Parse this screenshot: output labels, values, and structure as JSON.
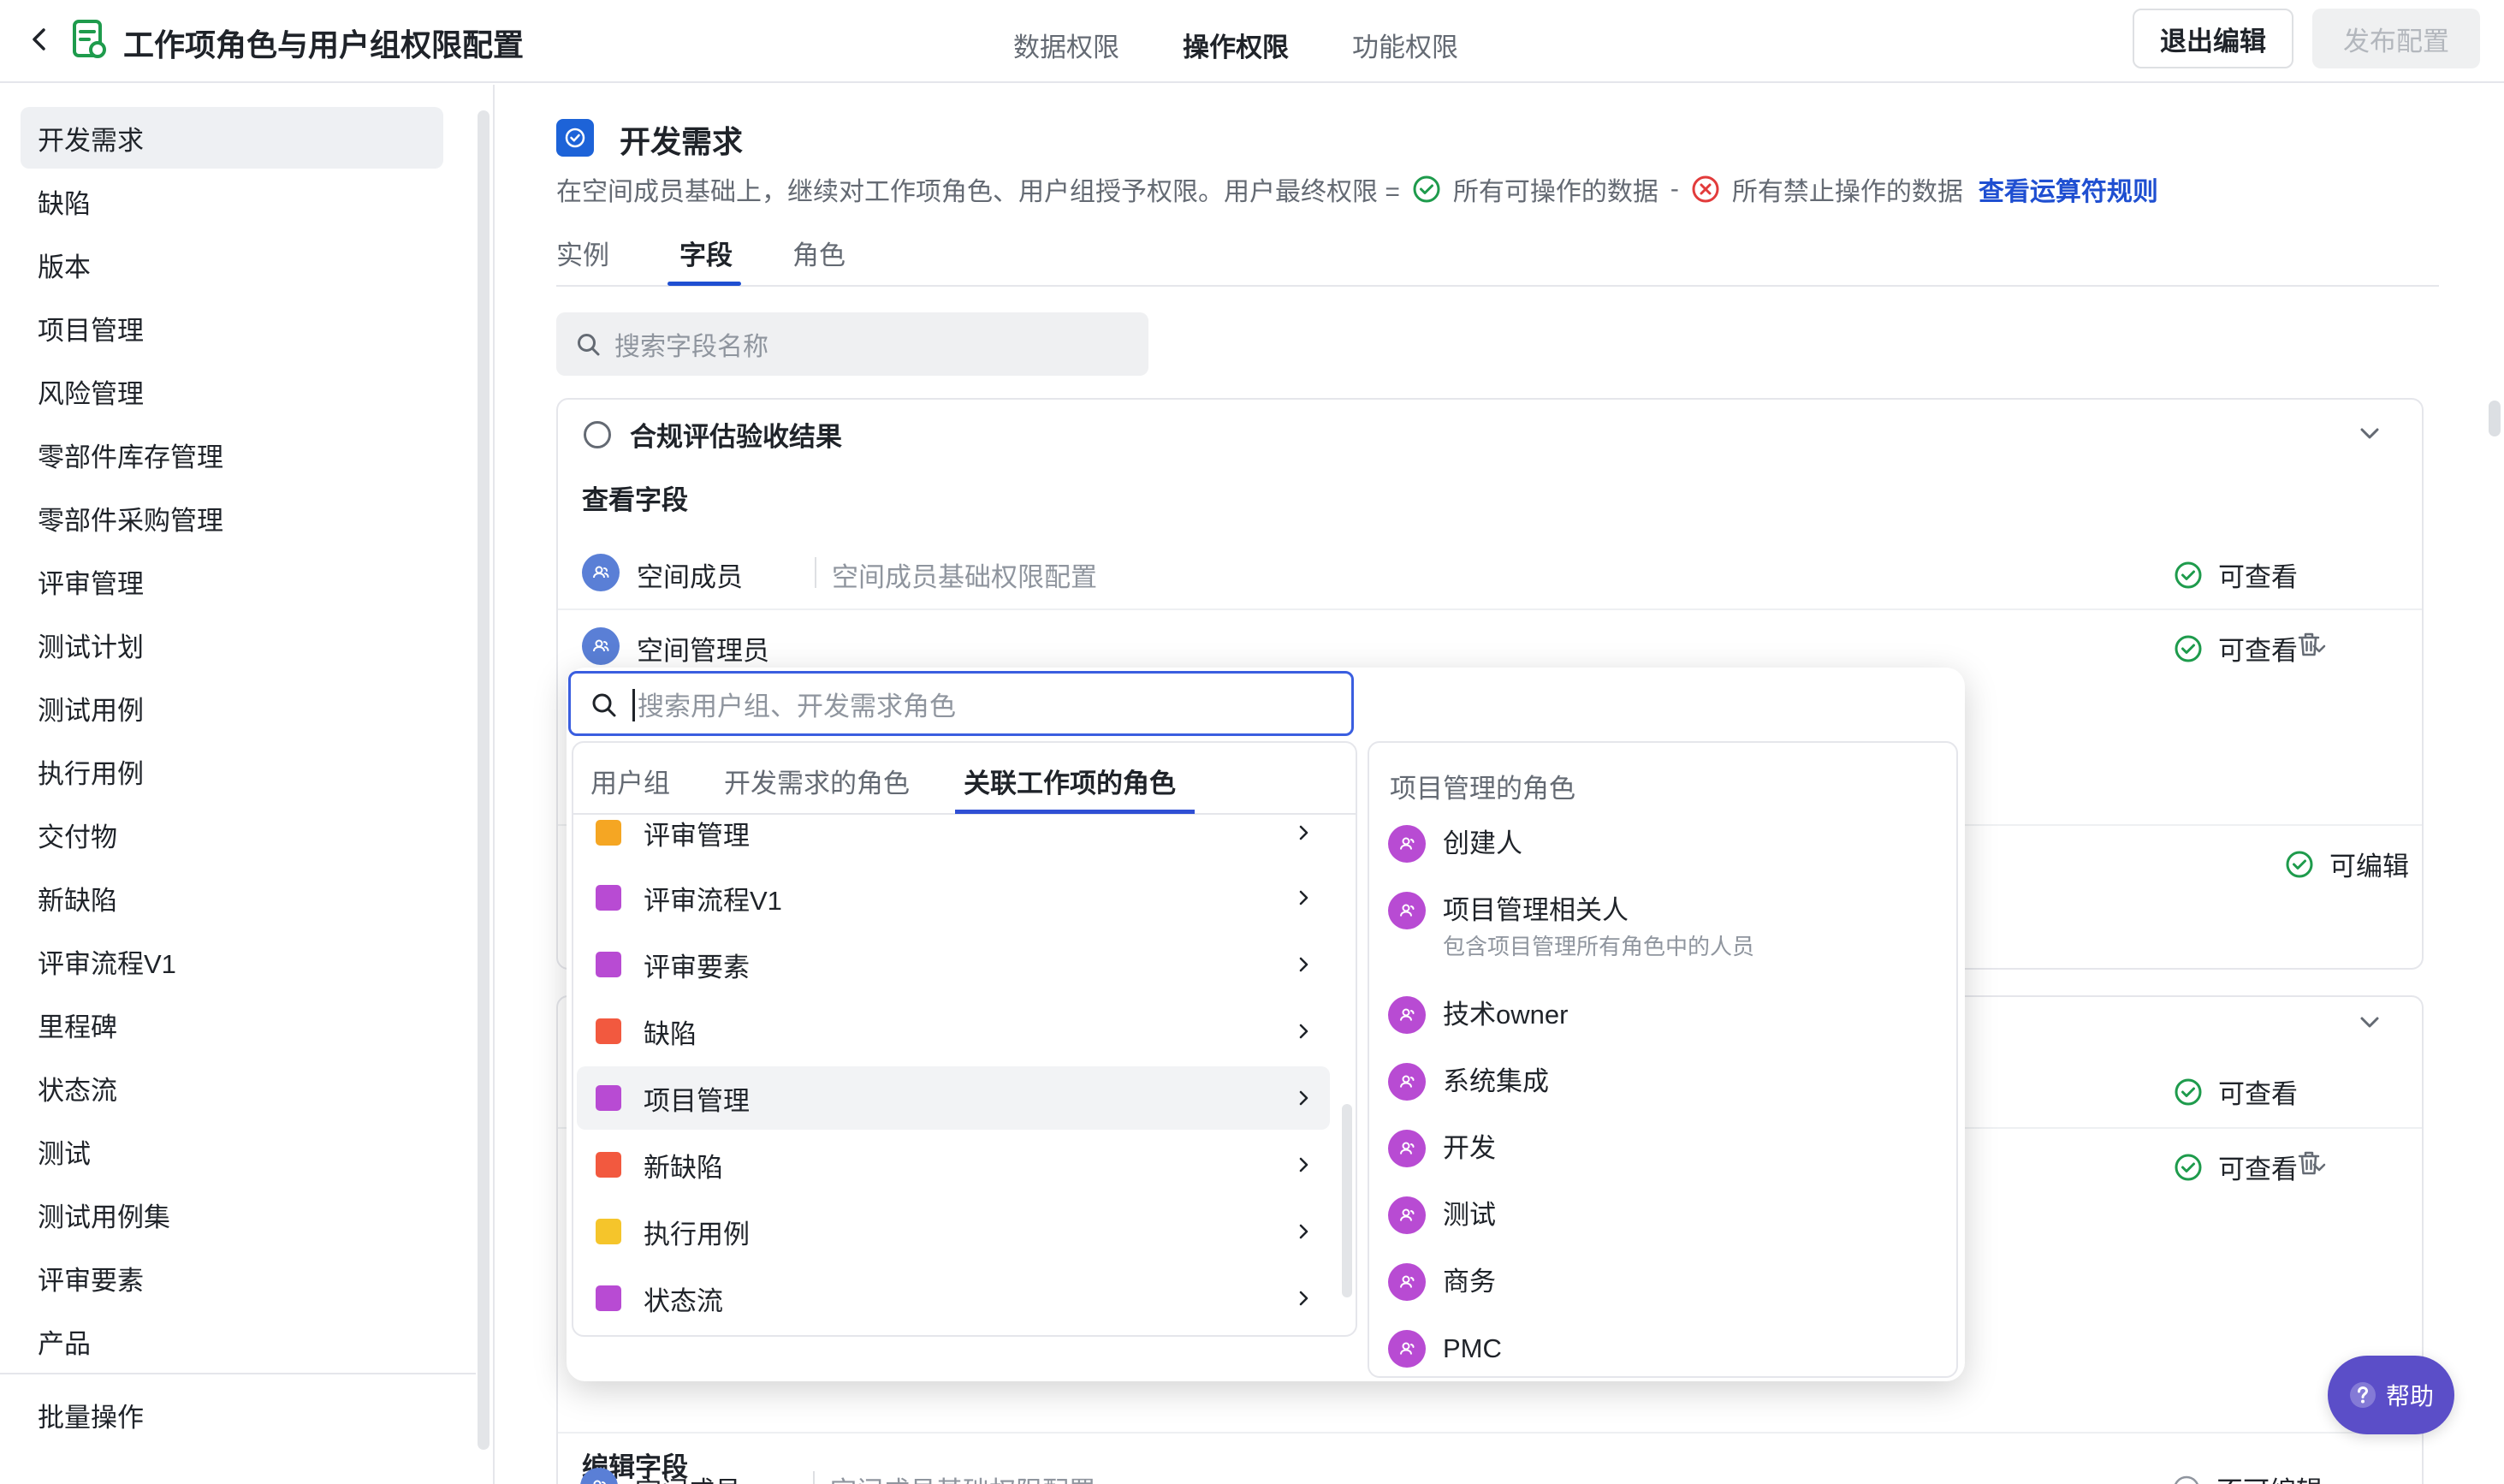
{
  "header": {
    "title": "工作项角色与用户组权限配置",
    "tabs": [
      "数据权限",
      "操作权限",
      "功能权限"
    ],
    "active_tab": "操作权限",
    "exit_label": "退出编辑",
    "publish_label": "发布配置"
  },
  "sidebar": {
    "items": [
      "开发需求",
      "缺陷",
      "版本",
      "项目管理",
      "风险管理",
      "零部件库存管理",
      "零部件采购管理",
      "评审管理",
      "测试计划",
      "测试用例",
      "执行用例",
      "交付物",
      "新缺陷",
      "评审流程V1",
      "里程碑",
      "状态流",
      "测试",
      "测试用例集",
      "评审要素",
      "产品"
    ],
    "active": "开发需求",
    "batch_label": "批量操作"
  },
  "main": {
    "title": "开发需求",
    "desc_prefix": "在空间成员基础上，继续对工作项角色、用户组授予权限。用户最终权限 =",
    "desc_allowed": "所有可操作的数据",
    "desc_minus": "-",
    "desc_denied": "所有禁止操作的数据",
    "desc_link": "查看运算符规则",
    "tabs": [
      "实例",
      "字段",
      "角色"
    ],
    "active_tab": "字段",
    "search_placeholder": "搜索字段名称",
    "card1": {
      "title": "合规评估验收结果",
      "view_label": "查看字段",
      "rows": [
        {
          "name": "空间成员",
          "sub": "空间成员基础权限配置",
          "perm": "可查看"
        },
        {
          "name": "空间管理员",
          "perm": "可查看"
        }
      ],
      "edit_perm": "可编辑"
    },
    "card2": {
      "rows": [
        {
          "perm": "可查看"
        },
        {
          "perm": "可查看"
        }
      ],
      "edit_label": "编辑字段",
      "edit_row": {
        "name": "空间成员",
        "sub": "空间成员基础权限配置",
        "perm": "不可编辑"
      }
    },
    "help_label": "帮助"
  },
  "popup": {
    "search_placeholder": "搜索用户组、开发需求角色",
    "tabs": [
      "用户组",
      "开发需求的角色",
      "关联工作项的角色"
    ],
    "active_tab": "关联工作项的角色",
    "items": [
      {
        "label": "评审管理",
        "color": "#f5a623"
      },
      {
        "label": "评审流程V1",
        "color": "#b84bd3"
      },
      {
        "label": "评审要素",
        "color": "#b84bd3"
      },
      {
        "label": "缺陷",
        "color": "#f2593f"
      },
      {
        "label": "项目管理",
        "color": "#b84bd3"
      },
      {
        "label": "新缺陷",
        "color": "#f2593f"
      },
      {
        "label": "执行用例",
        "color": "#f5c52b"
      },
      {
        "label": "状态流",
        "color": "#b84bd3"
      }
    ],
    "active_item": "项目管理",
    "right_header": "项目管理的角色",
    "roles": [
      {
        "name": "创建人"
      },
      {
        "name": "项目管理相关人",
        "desc": "包含项目管理所有角色中的人员"
      },
      {
        "name": "技术owner"
      },
      {
        "name": "系统集成"
      },
      {
        "name": "开发"
      },
      {
        "name": "测试"
      },
      {
        "name": "商务"
      },
      {
        "name": "PMC"
      }
    ]
  },
  "colors": {
    "accent": "#1f4fd1",
    "ok_green": "#1e9b4c",
    "deny_red": "#e23b3b",
    "role_purple": "#b84bd3",
    "member_blue": "#5a7fd6",
    "help_purple": "#5b4ec8"
  },
  "icons": [
    "back-arrow-icon",
    "app-doc-icon",
    "check-circle-icon",
    "x-circle-icon",
    "search-icon",
    "chevron-down-icon",
    "chevron-right-icon",
    "trash-icon",
    "user-group-icon",
    "help-icon",
    "minus-circle-icon"
  ]
}
